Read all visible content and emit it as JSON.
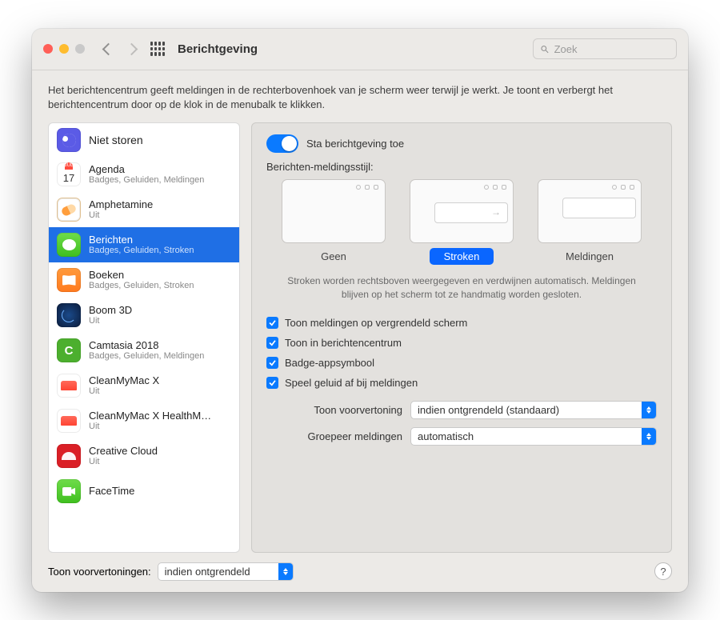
{
  "toolbar": {
    "title": "Berichtgeving",
    "search_placeholder": "Zoek"
  },
  "intro": "Het berichtencentrum geeft meldingen in de rechterbovenhoek van je scherm weer terwijl je werkt. Je toont en verbergt het berichtencentrum door op de klok in de menubalk te klikken.",
  "sidebar": {
    "dnd_label": "Niet storen",
    "cal_badge": "JUL",
    "cal_day": "17",
    "items": [
      {
        "name": "Agenda",
        "sub": "Badges, Geluiden, Meldingen"
      },
      {
        "name": "Amphetamine",
        "sub": "Uit"
      },
      {
        "name": "Berichten",
        "sub": "Badges, Geluiden, Stroken"
      },
      {
        "name": "Boeken",
        "sub": "Badges, Geluiden, Stroken"
      },
      {
        "name": "Boom 3D",
        "sub": "Uit"
      },
      {
        "name": "Camtasia 2018",
        "sub": "Badges, Geluiden, Meldingen"
      },
      {
        "name": "CleanMyMac X",
        "sub": "Uit"
      },
      {
        "name": "CleanMyMac X HealthM…",
        "sub": "Uit"
      },
      {
        "name": "Creative Cloud",
        "sub": "Uit"
      },
      {
        "name": "FaceTime",
        "sub": ""
      }
    ]
  },
  "panel": {
    "allow_label": "Sta berichtgeving toe",
    "style_heading": "Berichten-meldingsstijl:",
    "styles": {
      "none": "Geen",
      "banners": "Stroken",
      "alerts": "Meldingen"
    },
    "style_desc": "Stroken worden rechtsboven weergegeven en verdwijnen automatisch. Meldingen blijven op het scherm tot ze handmatig worden gesloten.",
    "checks": [
      "Toon meldingen op vergrendeld scherm",
      "Toon in berichtencentrum",
      "Badge-appsymbool",
      "Speel geluid af bij meldingen"
    ],
    "dd1_label": "Toon voorvertoning",
    "dd1_value": "indien ontgrendeld (standaard)",
    "dd2_label": "Groepeer meldingen",
    "dd2_value": "automatisch"
  },
  "footer": {
    "label": "Toon voorvertoningen:",
    "value": "indien ontgrendeld"
  }
}
